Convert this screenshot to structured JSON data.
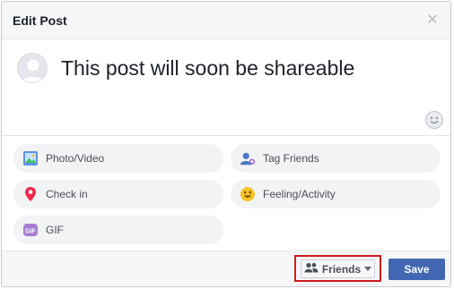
{
  "dialog": {
    "title": "Edit Post",
    "close_icon": "close-icon"
  },
  "composer": {
    "text": "This post will soon be shareable",
    "avatar_icon": "avatar-placeholder",
    "emoji_icon": "emoji-icon"
  },
  "options": [
    {
      "label": "Photo/Video",
      "icon": "photo-icon"
    },
    {
      "label": "Tag Friends",
      "icon": "tag-friends-icon"
    },
    {
      "label": "Check in",
      "icon": "location-pin-icon"
    },
    {
      "label": "Feeling/Activity",
      "icon": "smiley-icon"
    },
    {
      "label": "GIF",
      "icon": "gif-icon"
    }
  ],
  "footer": {
    "audience_label": "Friends",
    "audience_icon": "friends-icon",
    "save_label": "Save"
  },
  "colors": {
    "primary": "#4267b2",
    "highlight": "#d0191c"
  }
}
